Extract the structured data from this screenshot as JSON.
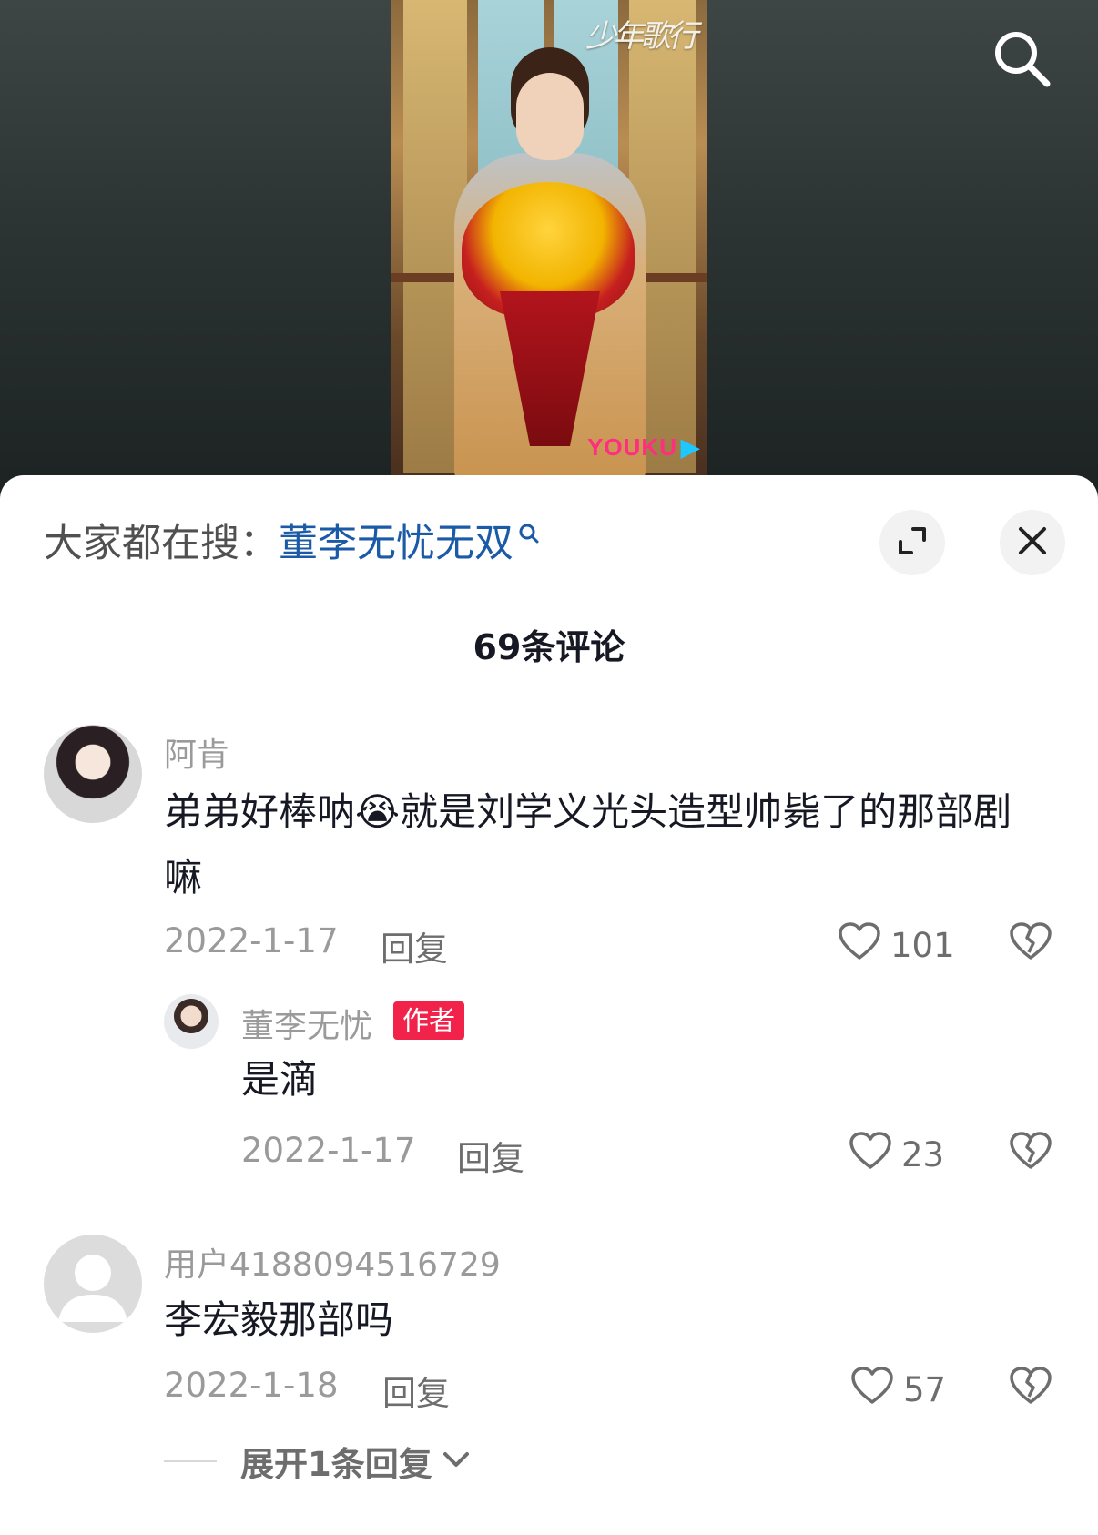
{
  "video": {
    "logo_text": "少年歌行",
    "brand": "YOUKU"
  },
  "sheet": {
    "hot_search_prefix": "大家都在搜：",
    "hot_search_keyword": "董李无忧无双",
    "comment_count_label": "69条评论"
  },
  "comments": [
    {
      "username": "阿肯",
      "text": "弟弟好棒呐😭就是刘学义光头造型帅毙了的那部剧嘛",
      "date": "2022-1-17",
      "reply_label": "回复",
      "likes": "101",
      "replies": [
        {
          "username": "董李无忧",
          "badge": "作者",
          "text": "是滴",
          "date": "2022-1-17",
          "reply_label": "回复",
          "likes": "23"
        }
      ]
    },
    {
      "username": "用户4188094516729",
      "text": "李宏毅那部吗",
      "date": "2022-1-18",
      "reply_label": "回复",
      "likes": "57",
      "expand_label": "展开1条回复"
    }
  ]
}
